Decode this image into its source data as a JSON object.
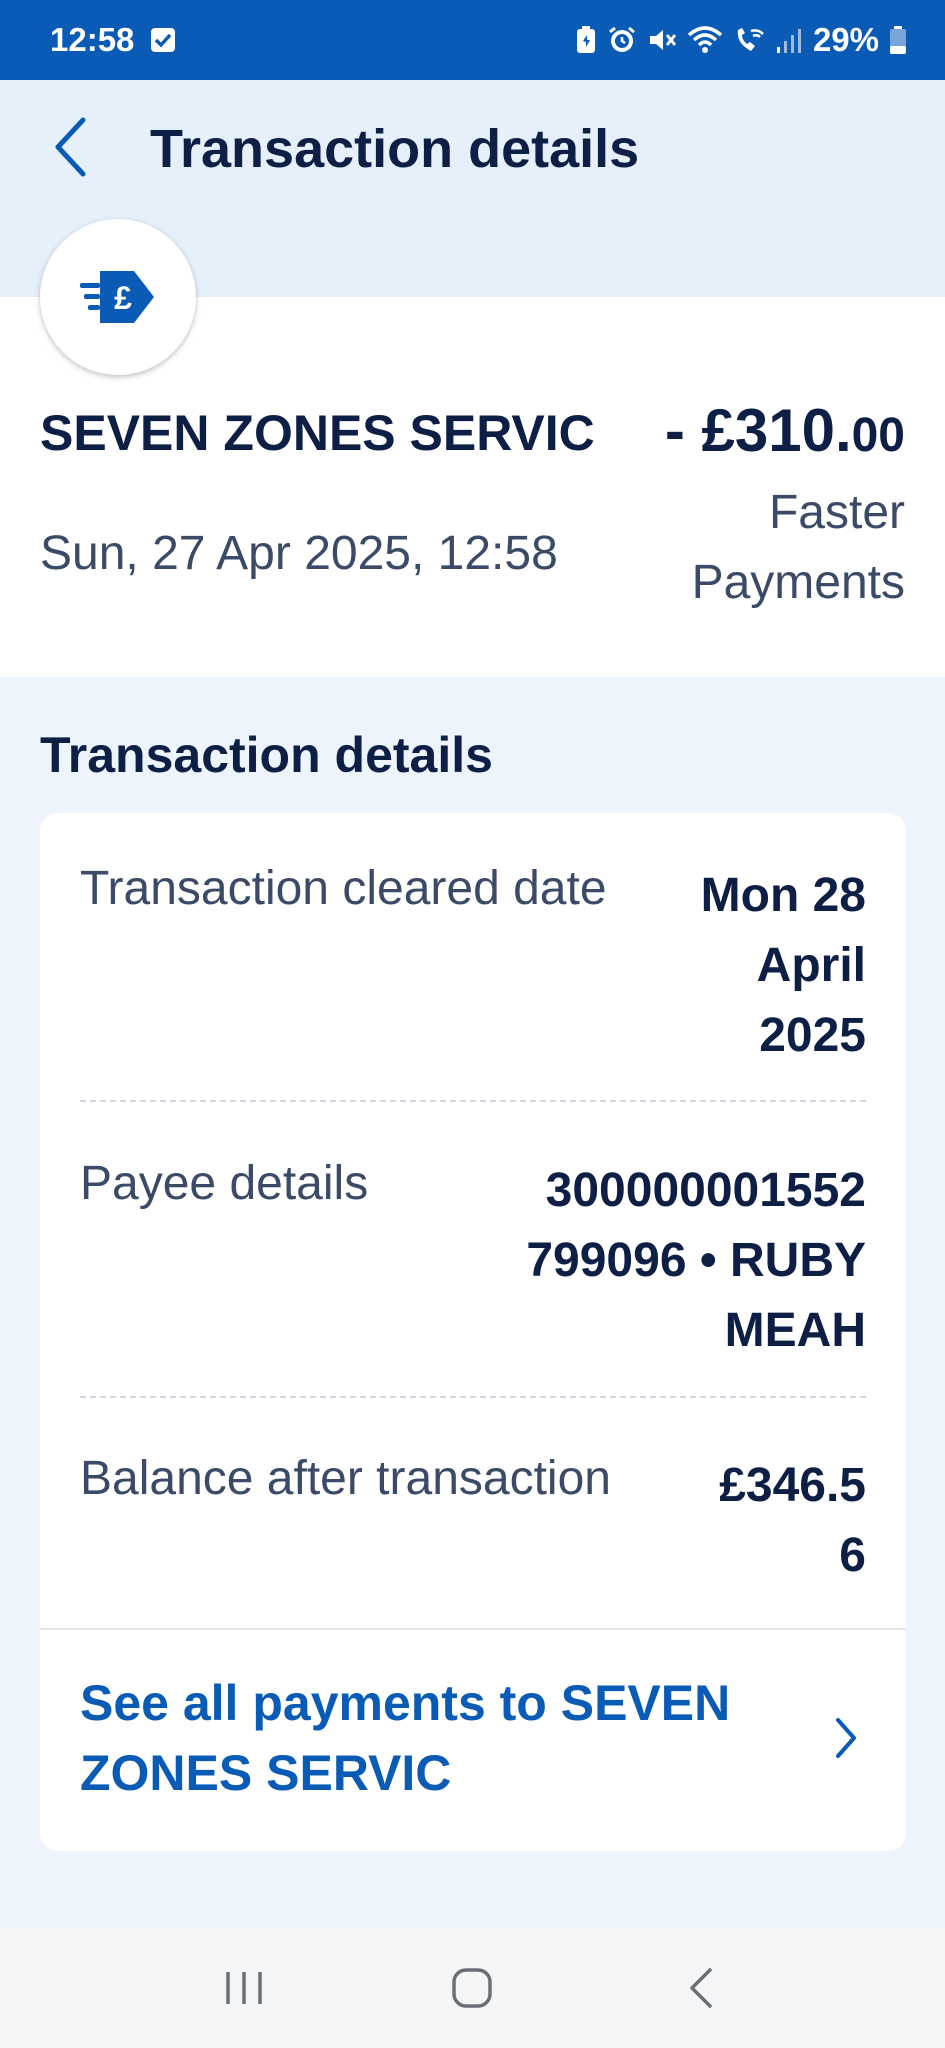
{
  "status_bar": {
    "time": "12:58",
    "battery": "29%",
    "icons": [
      "check-notification-icon",
      "battery-saver-icon",
      "alarm-icon",
      "mute-icon",
      "wifi-icon",
      "wifi-call-icon",
      "signal-icon",
      "battery-icon"
    ]
  },
  "header": {
    "title": "Transaction details",
    "back_icon": "chevron-left-icon"
  },
  "summary": {
    "merchant_icon": "faster-payment-pound-icon",
    "merchant_name": "SEVEN ZONES SERVIC",
    "date": "Sun, 27 Apr 2025, 12:58",
    "amount_main": "- £310.",
    "amount_pence": "00",
    "payment_type": "Faster Payments"
  },
  "details": {
    "section_title": "Transaction details",
    "rows": [
      {
        "label": "Transaction cleared date",
        "value": "Mon 28 April 2025"
      },
      {
        "label": "Payee details",
        "value": "300000001552 799096 • RUBY MEAH"
      },
      {
        "label": "Balance after transaction",
        "value": "£346.56"
      }
    ],
    "link_text": "See all payments to SEVEN ZONES SERVIC"
  },
  "nav": {
    "icons": [
      "recent-apps-icon",
      "home-icon",
      "back-icon"
    ]
  },
  "colors": {
    "brand_blue": "#0a5bb6",
    "text_dark": "#0d1f45",
    "text_muted": "#3b4a66",
    "page_bg": "#edf4fc"
  }
}
